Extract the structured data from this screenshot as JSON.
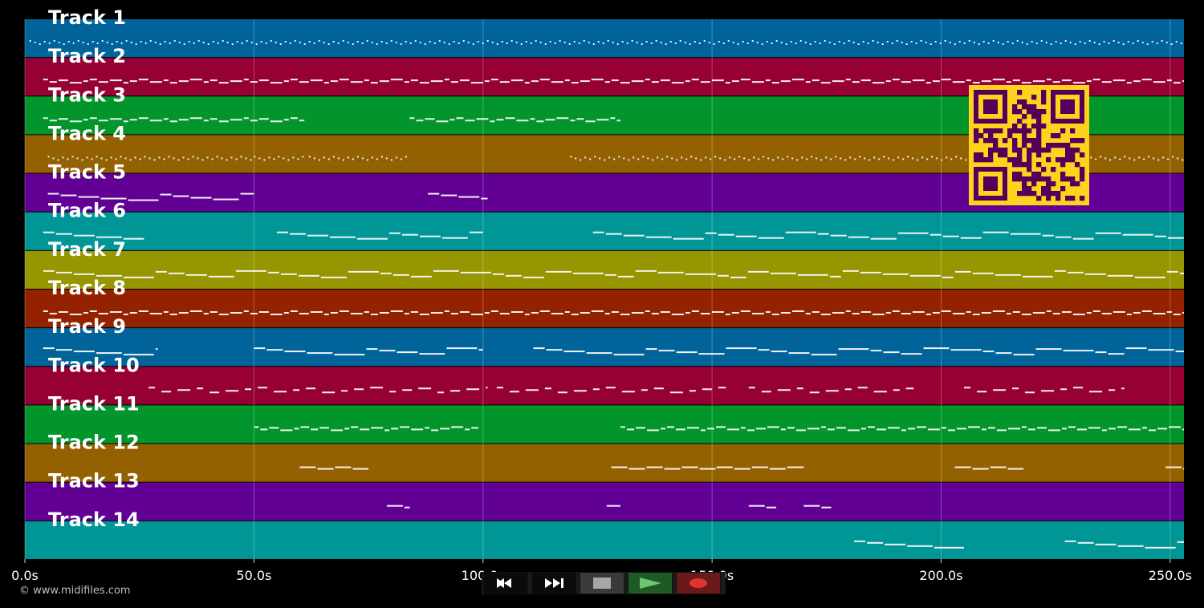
{
  "tracks": [
    {
      "label": "Track 1",
      "color": "#00639a"
    },
    {
      "label": "Track 2",
      "color": "#960035"
    },
    {
      "label": "Track 3",
      "color": "#01952c"
    },
    {
      "label": "Track 4",
      "color": "#946100"
    },
    {
      "label": "Track 5",
      "color": "#620096"
    },
    {
      "label": "Track 6",
      "color": "#009696"
    },
    {
      "label": "Track 7",
      "color": "#969600"
    },
    {
      "label": "Track 8",
      "color": "#942100"
    },
    {
      "label": "Track 9",
      "color": "#00639a"
    },
    {
      "label": "Track 10",
      "color": "#960035"
    },
    {
      "label": "Track 11",
      "color": "#01952c"
    },
    {
      "label": "Track 12",
      "color": "#946100"
    },
    {
      "label": "Track 13",
      "color": "#620096"
    },
    {
      "label": "Track 14",
      "color": "#009696"
    }
  ],
  "time_axis": {
    "ticks": [
      {
        "value": 0,
        "label": "0.0s"
      },
      {
        "value": 50,
        "label": "50.0s"
      },
      {
        "value": 100,
        "label": "100.0s"
      },
      {
        "value": 150,
        "label": "150.0s"
      },
      {
        "value": 200,
        "label": "200.0s"
      },
      {
        "value": 250,
        "label": "250.0s"
      }
    ],
    "range": [
      0,
      253
    ]
  },
  "copyright": "© www.midifiles.com",
  "qr": {
    "color": "#ffd21e",
    "dark": "#52005a"
  },
  "transport": {
    "rewind": "rewind-icon",
    "fast_forward": "fast-forward-icon",
    "stop": "stop-icon",
    "play": "play-icon",
    "record": "record-icon"
  },
  "notes": [
    {
      "track": 1,
      "segments": [
        [
          1,
          253
        ]
      ],
      "style": "dots"
    },
    {
      "track": 2,
      "segments": [
        [
          4,
          253
        ]
      ],
      "style": "dense"
    },
    {
      "track": 3,
      "segments": [
        [
          4,
          61
        ],
        [
          84,
          130
        ]
      ],
      "style": "dense"
    },
    {
      "track": 4,
      "segments": [
        [
          5,
          50
        ],
        [
          50,
          61
        ],
        [
          62,
          84
        ],
        [
          119,
          253
        ]
      ],
      "style": "dots"
    },
    {
      "track": 5,
      "segments": [
        [
          5,
          50
        ],
        [
          88,
          101
        ]
      ],
      "style": "line"
    },
    {
      "track": 6,
      "segments": [
        [
          4,
          26
        ],
        [
          55,
          100
        ],
        [
          124,
          253
        ]
      ],
      "style": "line"
    },
    {
      "track": 7,
      "segments": [
        [
          4,
          253
        ]
      ],
      "style": "line"
    },
    {
      "track": 8,
      "segments": [
        [
          4,
          253
        ]
      ],
      "style": "dense"
    },
    {
      "track": 9,
      "segments": [
        [
          4,
          29
        ],
        [
          50,
          100
        ],
        [
          111,
          253
        ]
      ],
      "style": "line"
    },
    {
      "track": 10,
      "segments": [
        [
          27,
          101
        ],
        [
          103,
          153
        ],
        [
          158,
          194
        ],
        [
          205,
          240
        ]
      ],
      "style": "dashes"
    },
    {
      "track": 11,
      "segments": [
        [
          50,
          61
        ],
        [
          61,
          99
        ],
        [
          130,
          253
        ]
      ],
      "style": "dense"
    },
    {
      "track": 12,
      "segments": [
        [
          60,
          75
        ],
        [
          128,
          151
        ],
        [
          151,
          167
        ],
        [
          167,
          170
        ],
        [
          203,
          218
        ],
        [
          249,
          253
        ]
      ],
      "style": "blocks"
    },
    {
      "track": 13,
      "segments": [
        [
          79,
          84
        ],
        [
          127,
          130
        ],
        [
          158,
          164
        ],
        [
          170,
          176
        ]
      ],
      "style": "blocks"
    },
    {
      "track": 14,
      "segments": [
        [
          181,
          205
        ],
        [
          227,
          253
        ]
      ],
      "style": "line"
    }
  ]
}
